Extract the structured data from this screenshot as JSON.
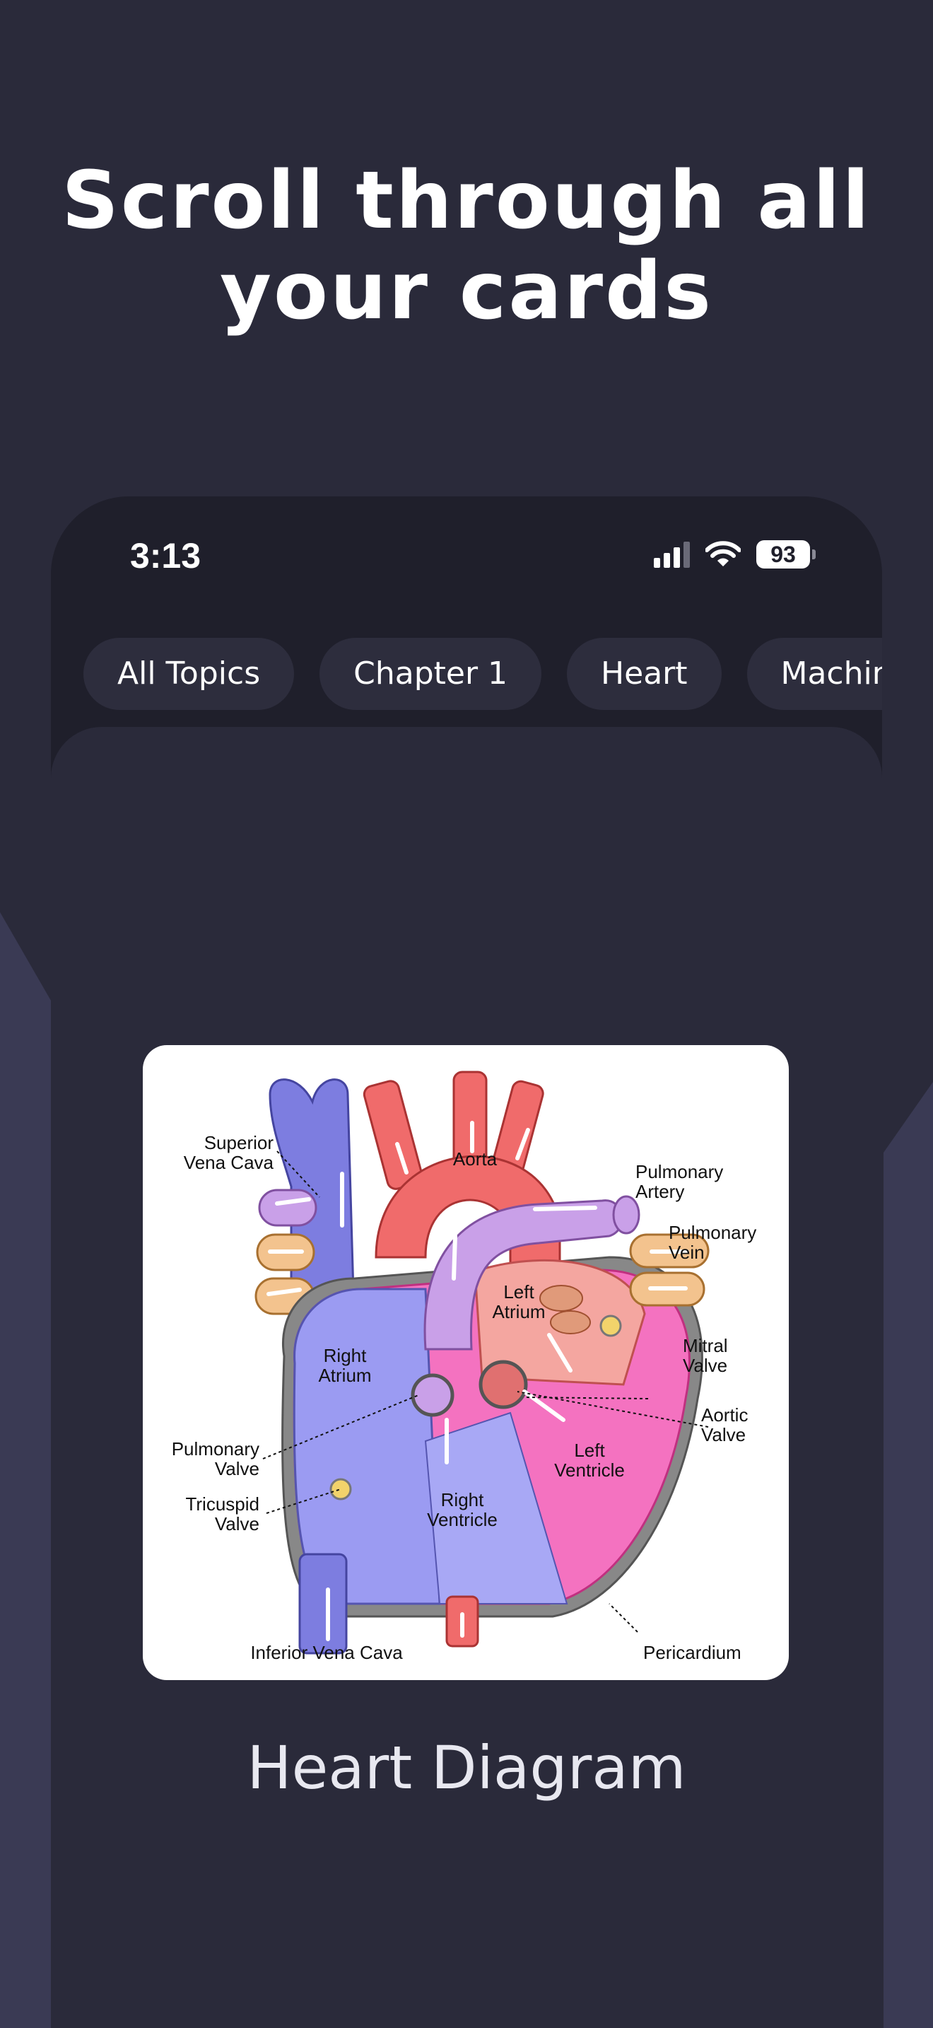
{
  "headline": {
    "line1": "Scroll through all",
    "line2": "your cards"
  },
  "status_bar": {
    "time": "3:13",
    "battery": "93",
    "icons": [
      "cellular-signal-icon",
      "wifi-icon",
      "battery-icon"
    ]
  },
  "topics": [
    "All Topics",
    "Chapter 1",
    "Heart",
    "Machine"
  ],
  "card": {
    "title": "Heart Diagram",
    "diagram_labels": {
      "superior_vena_cava_1": "Superior",
      "superior_vena_cava_2": "Vena Cava",
      "aorta": "Aorta",
      "pulmonary_artery_1": "Pulmonary",
      "pulmonary_artery_2": "Artery",
      "pulmonary_vein_1": "Pulmonary",
      "pulmonary_vein_2": "Vein",
      "left_atrium_1": "Left",
      "left_atrium_2": "Atrium",
      "right_atrium_1": "Right",
      "right_atrium_2": "Atrium",
      "mitral_valve_1": "Mitral",
      "mitral_valve_2": "Valve",
      "aortic_valve_1": "Aortic",
      "aortic_valve_2": "Valve",
      "pulmonary_valve_1": "Pulmonary",
      "pulmonary_valve_2": "Valve",
      "left_ventricle_1": "Left",
      "left_ventricle_2": "Ventricle",
      "tricuspid_valve_1": "Tricuspid",
      "tricuspid_valve_2": "Valve",
      "right_ventricle_1": "Right",
      "right_ventricle_2": "Ventricle",
      "inferior_vena_cava": "Inferior Vena Cava",
      "pericardium": "Pericardium"
    }
  },
  "colors": {
    "background": "#2a2a3a",
    "phone_frame": "#1f1f2b",
    "chip": "#2d2d3d",
    "side_shape": "#3a3a54"
  }
}
